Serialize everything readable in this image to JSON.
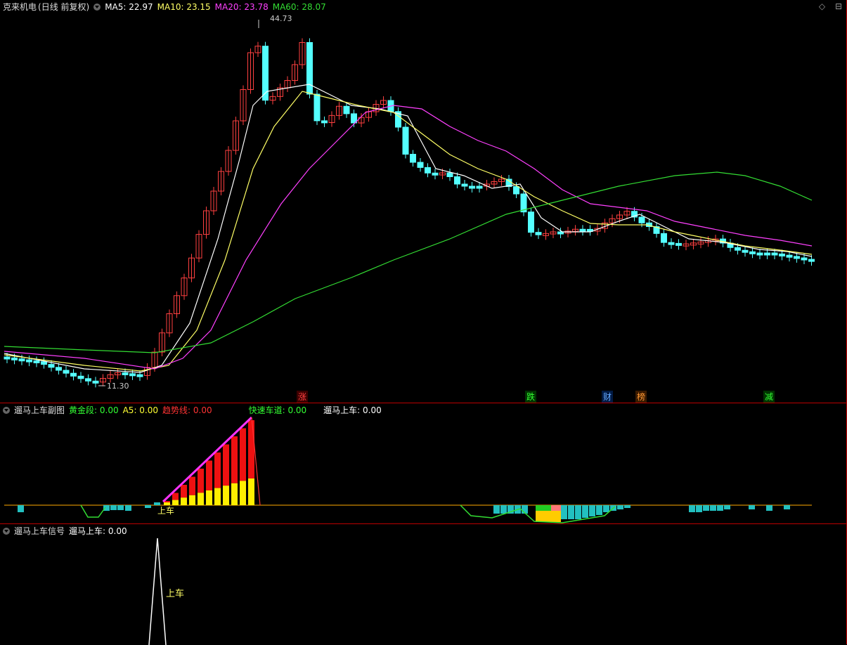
{
  "main": {
    "stock": "克来机电",
    "period": "(日线 前复权)",
    "ma": [
      {
        "label": "MA5: 22.97",
        "color": "#ffffff"
      },
      {
        "label": "MA10: 23.15",
        "color": "#ffff66"
      },
      {
        "label": "MA20: 23.78",
        "color": "#ff40ff"
      },
      {
        "label": "MA60: 28.07",
        "color": "#33dd33"
      }
    ],
    "high_label": "44.73",
    "low_label": "11.30",
    "events": [
      {
        "text": "涨",
        "color": "#ff4040",
        "bg": "#3a0000"
      },
      {
        "text": "跌",
        "color": "#33ff33",
        "bg": "#003300"
      },
      {
        "text": "财",
        "color": "#66aaff",
        "bg": "#001a44"
      },
      {
        "text": "榜",
        "color": "#ff9933",
        "bg": "#3a1a00"
      },
      {
        "text": "减",
        "color": "#33ff33",
        "bg": "#003300"
      }
    ],
    "colors": {
      "up": "#ff4040",
      "down": "#54ffff",
      "ma5": "#ffffff",
      "ma10": "#ffff66",
      "ma20": "#ff40ff",
      "ma60": "#33dd33"
    },
    "icons": [
      "diamond-icon",
      "settings-icon"
    ]
  },
  "sub": {
    "title": "遛马上车副图",
    "items": [
      {
        "label": "黄金段: 0.00",
        "color": "#33ff33"
      },
      {
        "label": "A5: 0.00",
        "color": "#ffff33"
      },
      {
        "label": "趋势线: 0.00",
        "color": "#ff3333"
      },
      {
        "label": "快速车道: 0.00",
        "color": "#33ff33"
      },
      {
        "label": "遛马上车: 0.00",
        "color": "#ffffff"
      }
    ],
    "signal_text": "上车"
  },
  "sig": {
    "title": "遛马上车信号",
    "item": {
      "label": "遛马上车: 0.00",
      "color": "#ffffff"
    },
    "signal_text": "上车"
  }
}
